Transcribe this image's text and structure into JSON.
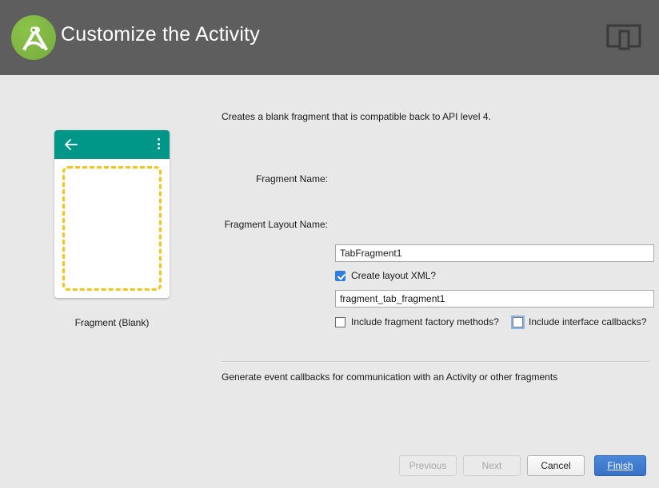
{
  "header": {
    "title": "Customize the Activity",
    "logo_icon": "android-studio-logo",
    "device_icon": "tablet-phone-preview-icon",
    "background_color": "#5e5e5e",
    "logo_color": "#7cb342"
  },
  "preview": {
    "caption": "Fragment (Blank)",
    "appbar_color": "#009688",
    "dashed_border_color": "#f5c518",
    "back_icon": "arrow-back-icon",
    "overflow_icon": "overflow-menu-icon"
  },
  "form": {
    "description": "Creates a blank fragment that is compatible back to API level 4.",
    "fields": [
      {
        "label": "Fragment Name:",
        "value": "TabFragment1",
        "placeholder": "Fragment Name"
      },
      {
        "label": "Fragment Layout Name:",
        "value": "fragment_tab_fragment1",
        "placeholder": "Fragment Layout Name"
      }
    ],
    "checkboxes": [
      {
        "label": "Create layout XML?",
        "checked": true,
        "focused": false
      },
      {
        "label": "Include fragment factory methods?",
        "checked": false,
        "focused": false
      },
      {
        "label": "Include interface callbacks?",
        "checked": false,
        "focused": true
      }
    ],
    "footer_note": "Generate event callbacks for communication with an Activity or other fragments"
  },
  "buttons": {
    "previous": "Previous",
    "next": "Next",
    "cancel": "Cancel",
    "finish": "Finish",
    "finish_mnemonic": "Finish",
    "default_button_color": "#3a72c6"
  }
}
